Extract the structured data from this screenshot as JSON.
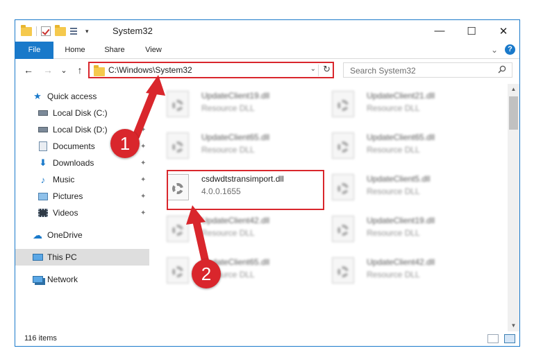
{
  "window": {
    "title": "System32",
    "controls": {
      "minimize": "—",
      "maximize": "☐",
      "close": "✕"
    }
  },
  "ribbon": {
    "tabs": [
      "File",
      "Home",
      "Share",
      "View"
    ],
    "collapse_glyph": "⌄",
    "help_glyph": "?"
  },
  "nav": {
    "back_glyph": "←",
    "forward_glyph": "→",
    "recent_glyph": "⌄",
    "up_glyph": "↑",
    "address": "C:\\Windows\\System32",
    "address_dropdown_glyph": "⌄",
    "refresh_glyph": "↻",
    "search_placeholder": "Search System32"
  },
  "sidebar": {
    "items": [
      {
        "label": "Quick access",
        "icon": "star-icon"
      },
      {
        "label": "Local Disk (C:)",
        "icon": "drive-icon"
      },
      {
        "label": "Local Disk (D:)",
        "icon": "drive-icon"
      },
      {
        "label": "Documents",
        "icon": "documents-icon"
      },
      {
        "label": "Downloads",
        "icon": "download-icon"
      },
      {
        "label": "Music",
        "icon": "music-icon"
      },
      {
        "label": "Pictures",
        "icon": "pictures-icon"
      },
      {
        "label": "Videos",
        "icon": "videos-icon"
      },
      {
        "label": "OneDrive",
        "icon": "cloud-icon"
      },
      {
        "label": "This PC",
        "icon": "computer-icon"
      },
      {
        "label": "Network",
        "icon": "network-icon"
      }
    ],
    "pin_glyph": "✦",
    "selected": "This PC"
  },
  "files": [
    {
      "name": "UpdateClient19.dll",
      "desc": "Resource DLL"
    },
    {
      "name": "UpdateClient21.dll",
      "desc": "Resource DLL"
    },
    {
      "name": "UpdateClient65.dll",
      "desc": "Resource DLL"
    },
    {
      "name": "UpdateClient65.dll",
      "desc": "Resource DLL"
    },
    {
      "name": "csdwdtstransimport.dll",
      "desc": "4.0.0.1655"
    },
    {
      "name": "UpdateClient5.dll",
      "desc": "Resource DLL"
    },
    {
      "name": "UpdateClient42.dll",
      "desc": "Resource DLL"
    },
    {
      "name": "UpdateClient19.dll",
      "desc": "Resource DLL"
    },
    {
      "name": "UpdateClient65.dll",
      "desc": "Resource DLL"
    },
    {
      "name": "UpdateClient42.dll",
      "desc": "Resource DLL"
    }
  ],
  "status": {
    "count": "116 items"
  },
  "annotations": {
    "callout1": "1",
    "callout2": "2"
  },
  "colors": {
    "accent": "#1979ca",
    "highlight": "#d9262c",
    "selected": "#dedede"
  }
}
